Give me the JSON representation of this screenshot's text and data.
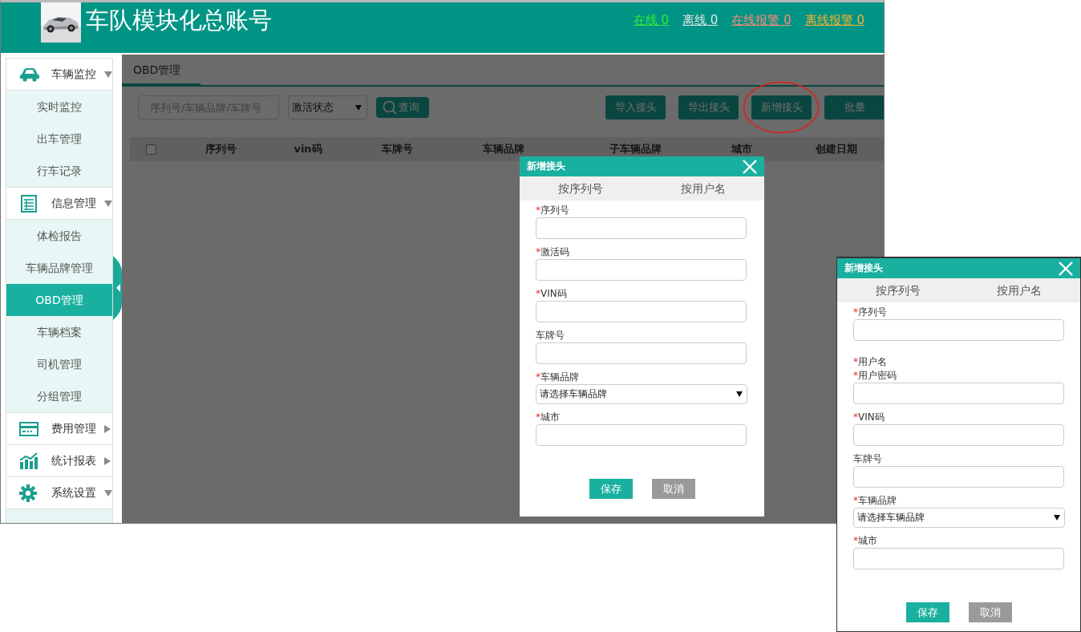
{
  "header": {
    "title": "车队模块化总账号",
    "status_links": [
      {
        "label": "在线 0",
        "color": "#33ee33"
      },
      {
        "label": "离线 0",
        "color": "#e6e6e6"
      },
      {
        "label": "在线报警 0",
        "color": "#ff8a75"
      },
      {
        "label": "离线报警 0",
        "color": "#ffb02e"
      }
    ]
  },
  "sidebar": {
    "groups": [
      {
        "label": "车辆监控",
        "expanded": true,
        "items": [
          {
            "label": "实时监控",
            "selected": false
          },
          {
            "label": "出车管理",
            "selected": false
          },
          {
            "label": "行车记录",
            "selected": false
          }
        ]
      },
      {
        "label": "信息管理",
        "expanded": true,
        "items": [
          {
            "label": "体检报告",
            "selected": false
          },
          {
            "label": "车辆品牌管理",
            "selected": false
          },
          {
            "label": "OBD管理",
            "selected": true
          },
          {
            "label": "车辆档案",
            "selected": false
          },
          {
            "label": "司机管理",
            "selected": false
          },
          {
            "label": "分组管理",
            "selected": false
          }
        ]
      },
      {
        "label": "费用管理",
        "expanded": false
      },
      {
        "label": "统计报表",
        "expanded": false
      },
      {
        "label": "系统设置",
        "expanded": true
      }
    ]
  },
  "content": {
    "tabs": [
      {
        "label": "OBD管理",
        "selected": true
      }
    ],
    "toolbar": {
      "search": {
        "placeholder": "序列号/车辆品牌/车牌号"
      },
      "status_select": {
        "value": "激活状态"
      },
      "query_button": "查询",
      "actions": [
        {
          "label": "导入接头",
          "highlighted": false
        },
        {
          "label": "导出接头",
          "highlighted": false
        },
        {
          "label": "新增接头",
          "highlighted": true
        },
        {
          "label": "批量",
          "highlighted": false
        }
      ]
    },
    "table": {
      "select_all": {
        "checked": false
      },
      "columns": [
        "序列号",
        "vin码",
        "车牌号",
        "车辆品牌",
        "子车辆品牌",
        "城市",
        "创建日期"
      ]
    }
  },
  "dialogs": [
    {
      "title": "新增接头",
      "tabs": [
        {
          "label": "按序列号"
        },
        {
          "label": "按用户名"
        }
      ],
      "fields": [
        {
          "kind": "input",
          "required_mark": "*",
          "label": "序列号"
        },
        {
          "kind": "input",
          "required_mark": "*",
          "label": "激活码"
        },
        {
          "kind": "input",
          "required_mark": "*",
          "label": "VIN码"
        },
        {
          "kind": "input",
          "label": "车牌号"
        },
        {
          "kind": "select",
          "required_mark": "*",
          "label": "车辆品牌",
          "value": "请选择车辆品牌"
        },
        {
          "kind": "input",
          "required_mark": "*",
          "label": "城市"
        }
      ],
      "buttons": [
        {
          "label": "保存",
          "kind": "primary"
        },
        {
          "label": "取消",
          "kind": "secondary"
        }
      ]
    },
    {
      "title": "新增接头",
      "tabs": [
        {
          "label": "按序列号"
        },
        {
          "label": "按用户名"
        }
      ],
      "fields": [
        {
          "kind": "input",
          "required_mark": "*",
          "label": "序列号"
        },
        {
          "kind": "label",
          "required_mark": "*",
          "label": "用户名"
        },
        {
          "kind": "input",
          "required_mark": "*",
          "label": "用户密码"
        },
        {
          "kind": "input",
          "required_mark": "*",
          "label": "VIN码"
        },
        {
          "kind": "input",
          "label": "车牌号"
        },
        {
          "kind": "select",
          "required_mark": "*",
          "label": "车辆品牌",
          "value": "请选择车辆品牌"
        },
        {
          "kind": "input",
          "required_mark": "*",
          "label": "城市"
        }
      ],
      "buttons": [
        {
          "label": "保存",
          "kind": "primary"
        },
        {
          "label": "取消",
          "kind": "secondary"
        }
      ]
    }
  ]
}
